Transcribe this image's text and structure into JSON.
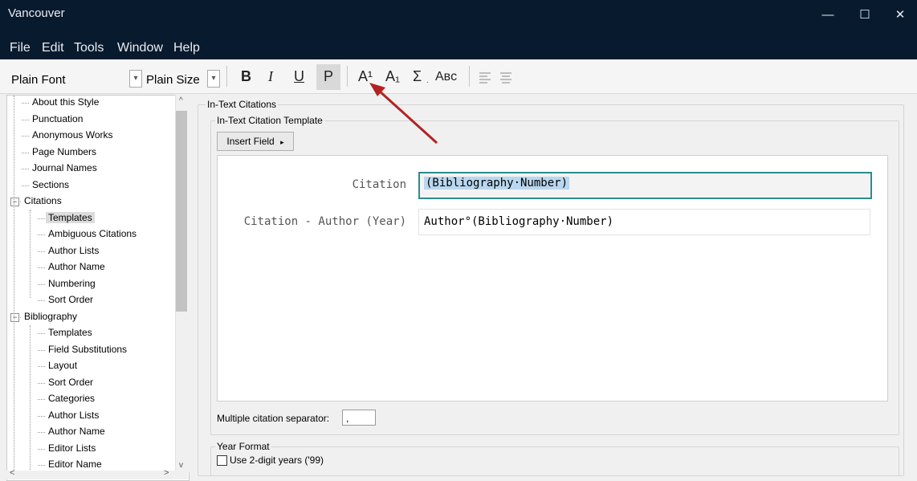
{
  "window": {
    "title": "Vancouver",
    "controls": [
      "—",
      "☐",
      "✕"
    ]
  },
  "menu": [
    "File",
    "Edit",
    "Tools",
    "Window",
    "Help"
  ],
  "toolbar": {
    "font": "Plain Font",
    "size": "Plain Size",
    "bold": "B",
    "italic": "I",
    "underline": "U",
    "plain": "P",
    "superscript": "A¹",
    "subscript": "A₁",
    "sigma": "Σ",
    "smallcaps": "Aʙᴄ"
  },
  "tree": [
    {
      "label": "About this Style",
      "level": 1
    },
    {
      "label": "Punctuation",
      "level": 1
    },
    {
      "label": "Anonymous Works",
      "level": 1
    },
    {
      "label": "Page Numbers",
      "level": 1
    },
    {
      "label": "Journal Names",
      "level": 1
    },
    {
      "label": "Sections",
      "level": 1
    },
    {
      "label": "Citations",
      "level": 0,
      "expanded": true
    },
    {
      "label": "Templates",
      "level": 2,
      "selected": true
    },
    {
      "label": "Ambiguous Citations",
      "level": 2
    },
    {
      "label": "Author Lists",
      "level": 2
    },
    {
      "label": "Author Name",
      "level": 2
    },
    {
      "label": "Numbering",
      "level": 2
    },
    {
      "label": "Sort Order",
      "level": 2
    },
    {
      "label": "Bibliography",
      "level": 0,
      "expanded": true
    },
    {
      "label": "Templates",
      "level": 2
    },
    {
      "label": "Field Substitutions",
      "level": 2
    },
    {
      "label": "Layout",
      "level": 2
    },
    {
      "label": "Sort Order",
      "level": 2
    },
    {
      "label": "Categories",
      "level": 2
    },
    {
      "label": "Author Lists",
      "level": 2
    },
    {
      "label": "Author Name",
      "level": 2
    },
    {
      "label": "Editor Lists",
      "level": 2
    },
    {
      "label": "Editor Name",
      "level": 2
    }
  ],
  "panel": {
    "group_title": "In-Text Citations",
    "template_group_title": "In-Text Citation Template",
    "insert_field": "Insert Field",
    "fields": [
      {
        "label": "Citation",
        "value": "(Bibliography·Number)"
      },
      {
        "label": "Citation - Author (Year)",
        "value": "Author°(Bibliography·Number)"
      }
    ],
    "separator_label": "Multiple citation separator:",
    "separator_value": ",",
    "year_group_title": "Year Format",
    "year_checkbox": "Use 2-digit years ('99)",
    "year_checked": false
  },
  "colors": {
    "titlebar": "#081a2e",
    "accent": "#2b8c8c",
    "arrow": "#b22222",
    "highlight": "#b9d7ee"
  }
}
